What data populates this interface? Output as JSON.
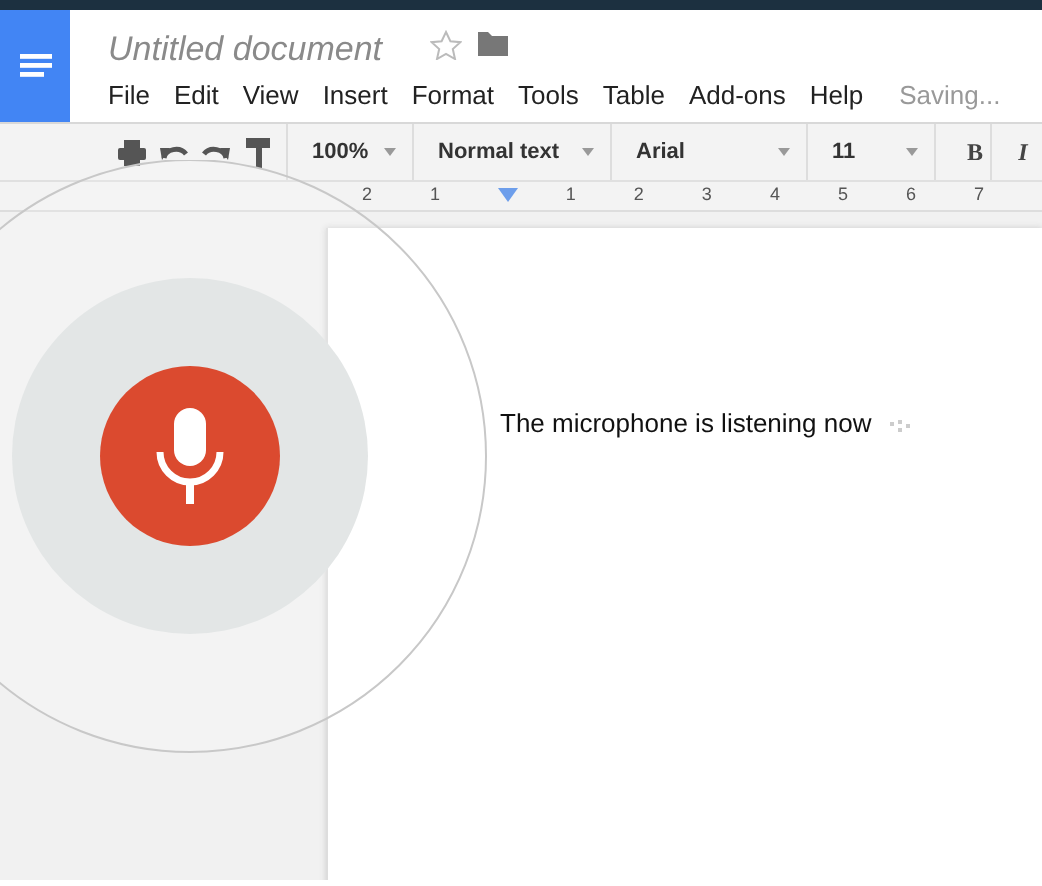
{
  "document": {
    "title": "Untitled document",
    "starred": false
  },
  "menu": [
    "File",
    "Edit",
    "View",
    "Insert",
    "Format",
    "Tools",
    "Table",
    "Add-ons",
    "Help"
  ],
  "save_status": "Saving...",
  "toolbar": {
    "zoom": "100%",
    "style": "Normal text",
    "font": "Arial",
    "size": "11",
    "bold": "B",
    "italic": "I"
  },
  "ruler": [
    "2",
    "1",
    "1",
    "2",
    "3",
    "4",
    "5",
    "6",
    "7"
  ],
  "body_text": "The microphone is listening now",
  "voice": {
    "listening": true
  }
}
